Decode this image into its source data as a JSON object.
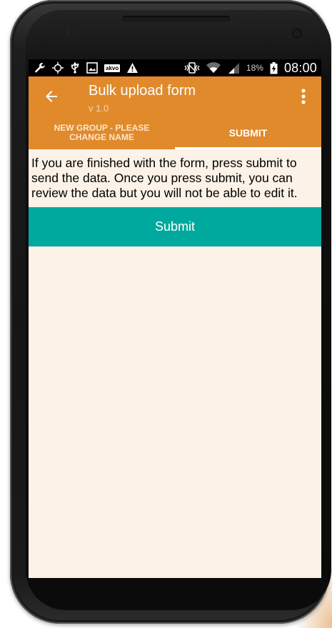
{
  "status_bar": {
    "battery_percent": "18%",
    "time": "08:00",
    "left_icons": [
      "wrench-icon",
      "gps-icon",
      "usb-icon",
      "gallery-icon",
      "akvo-icon",
      "warning-icon"
    ],
    "right_icons": [
      "vibrate-icon",
      "wifi-icon",
      "signal-icon",
      "battery-charging-icon"
    ],
    "akvo_label": "akvo"
  },
  "app_bar": {
    "title": "Bulk upload form",
    "subtitle": "v 1.0",
    "back_icon": "arrow-left-icon",
    "menu_icon": "more-vert-icon",
    "color": "#e08a2c"
  },
  "tabs": [
    {
      "label": "NEW GROUP - PLEASE CHANGE NAME",
      "active": false
    },
    {
      "label": "SUBMIT",
      "active": true
    }
  ],
  "content": {
    "instructions": "If you are finished with the form, press submit to send the data. Once you press submit, you can review the data but you will not be able to edit it.",
    "submit_label": "Submit",
    "submit_color": "#00a99d"
  },
  "colors": {
    "background": "#fdf2e7"
  }
}
